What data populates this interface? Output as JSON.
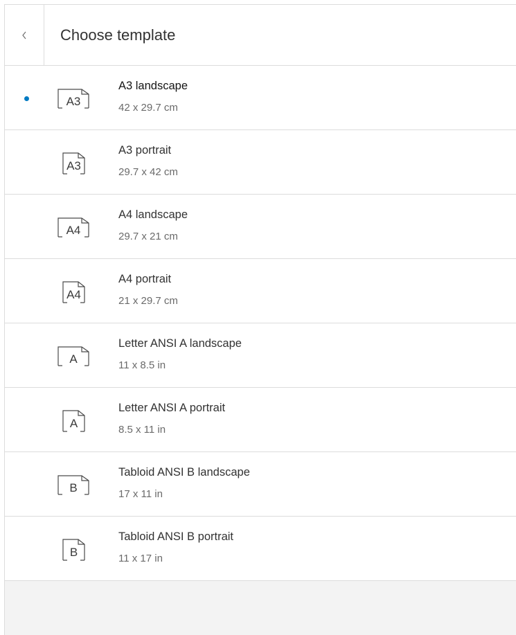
{
  "header": {
    "back_icon": "chevron-left-icon",
    "title": "Choose template"
  },
  "colors": {
    "selected_dot": "#007ac2",
    "footer_background": "#f3f3f3"
  },
  "templates": [
    {
      "name": "A3 landscape",
      "dims": "42 x 29.7 cm",
      "icon_label": "A3",
      "orientation": "landscape",
      "selected": true
    },
    {
      "name": "A3 portrait",
      "dims": "29.7 x 42 cm",
      "icon_label": "A3",
      "orientation": "portrait",
      "selected": false
    },
    {
      "name": "A4 landscape",
      "dims": "29.7 x 21 cm",
      "icon_label": "A4",
      "orientation": "landscape",
      "selected": false
    },
    {
      "name": "A4 portrait",
      "dims": "21 x 29.7 cm",
      "icon_label": "A4",
      "orientation": "portrait",
      "selected": false
    },
    {
      "name": "Letter ANSI A landscape",
      "dims": "11 x 8.5 in",
      "icon_label": "A",
      "orientation": "landscape",
      "selected": false
    },
    {
      "name": "Letter ANSI A portrait",
      "dims": "8.5 x 11 in",
      "icon_label": "A",
      "orientation": "portrait",
      "selected": false
    },
    {
      "name": "Tabloid ANSI B landscape",
      "dims": "17 x 11 in",
      "icon_label": "B",
      "orientation": "landscape",
      "selected": false
    },
    {
      "name": "Tabloid ANSI B portrait",
      "dims": "11 x 17 in",
      "icon_label": "B",
      "orientation": "portrait",
      "selected": false
    }
  ]
}
